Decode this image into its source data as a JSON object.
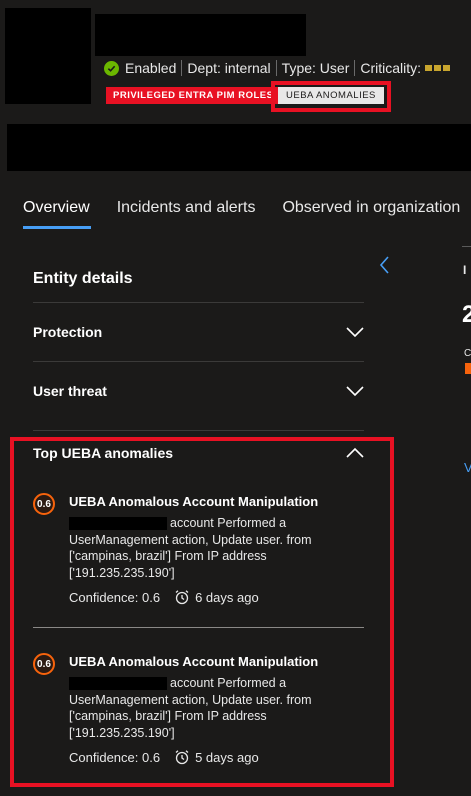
{
  "header": {
    "status": "Enabled",
    "department": "Dept: internal",
    "type": "Type: User",
    "criticality_label": "Criticality:",
    "criticality_level": 3,
    "tags": [
      "PRIVILEGED ENTRA PIM ROLES",
      "UEBA ANOMALIES"
    ]
  },
  "tabs": [
    {
      "label": "Overview",
      "active": true
    },
    {
      "label": "Incidents and alerts",
      "active": false
    },
    {
      "label": "Observed in organization",
      "active": false
    }
  ],
  "side_peek": {
    "label_initial": "I",
    "count": "2",
    "caption_initial": "C",
    "link_initial": "V"
  },
  "entity_details": {
    "title": "Entity details",
    "sections": [
      {
        "label": "Protection",
        "expanded": false
      },
      {
        "label": "User threat",
        "expanded": false
      }
    ]
  },
  "ueba": {
    "title": "Top UEBA anomalies",
    "expanded": true,
    "items": [
      {
        "score": "0.6",
        "title": "UEBA Anomalous Account Manipulation",
        "description": "account Performed a UserManagement action, Update user. from ['campinas, brazil'] From IP address ['191.235.235.190']",
        "confidence": "Confidence: 0.6",
        "age": "6 days ago"
      },
      {
        "score": "0.6",
        "title": "UEBA Anomalous Account Manipulation",
        "description": "account Performed a UserManagement action, Update user. from ['campinas, brazil'] From IP address ['191.235.235.190']",
        "confidence": "Confidence: 0.6",
        "age": "5 days ago"
      }
    ]
  },
  "colors": {
    "accent": "#479ef5",
    "highlight": "#e81123",
    "enabled": "#6bb700",
    "score": "#f7630c",
    "criticality": "#c8a52e"
  }
}
